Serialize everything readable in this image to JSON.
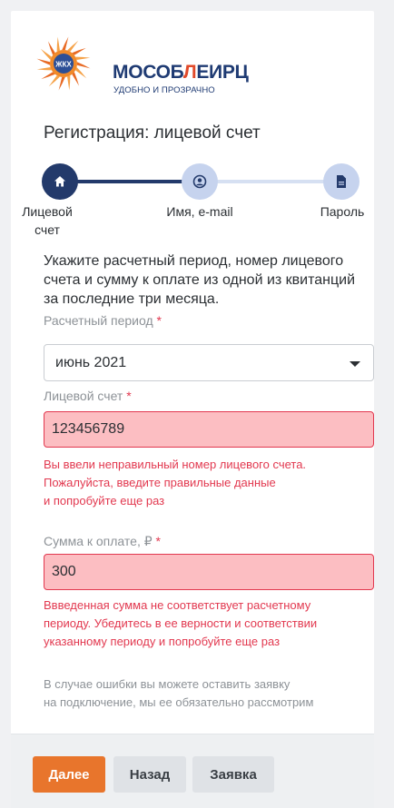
{
  "brand": {
    "name_prefix": "МОСОБ",
    "name_accent": "Л",
    "name_suffix": "ЕИРЦ",
    "tagline": "УДОБНО И ПРОЗРАЧНО",
    "emblem_text": "ЖКХ",
    "colors": {
      "navy": "#1f3b73",
      "red": "#e14a2a",
      "orange": "#f08a2a"
    }
  },
  "page": {
    "title": "Регистрация: лицевой счет"
  },
  "stepper": {
    "steps": [
      {
        "label_line1": "Лицевой",
        "label_line2": "счет",
        "icon": "home-icon",
        "state": "active"
      },
      {
        "label_line1": "Имя, e-mail",
        "label_line2": "",
        "icon": "user-icon",
        "state": "next"
      },
      {
        "label_line1": "Пароль",
        "label_line2": "",
        "icon": "document-icon",
        "state": "pending"
      }
    ],
    "colors": {
      "active": "#233a6b",
      "inactive": "#c6d3ee",
      "line_inactive": "#d6e0f2"
    }
  },
  "instructions": "Укажите расчетный период, номер лицевого счета и сумму к оплате из одной из квитанций за последние три месяца.",
  "form": {
    "period": {
      "label": "Расчетный период",
      "required_mark": "*",
      "value": "июнь 2021"
    },
    "account": {
      "label": "Лицевой счет",
      "required_mark": "*",
      "value": "123456789",
      "error_lines": [
        "Вы ввели неправильный номер лицевого счета.",
        "Пожалуйста, введите правильные данные",
        "и попробуйте еще раз"
      ]
    },
    "amount": {
      "label": "Сумма к оплате, ₽",
      "required_mark": "*",
      "value": "300",
      "error_lines": [
        "Ввведенная сумма не соответствует расчетному",
        "периоду. Убедитесь в ее верности и соответствии",
        "указанному периоду и попробуйте еще раз"
      ]
    },
    "hint_lines": [
      "В случае ошибки вы можете оставить заявку",
      "на подключение, мы ее обязательно рассмотрим"
    ]
  },
  "footer": {
    "next_label": "Далее",
    "back_label": "Назад",
    "request_label": "Заявка"
  }
}
